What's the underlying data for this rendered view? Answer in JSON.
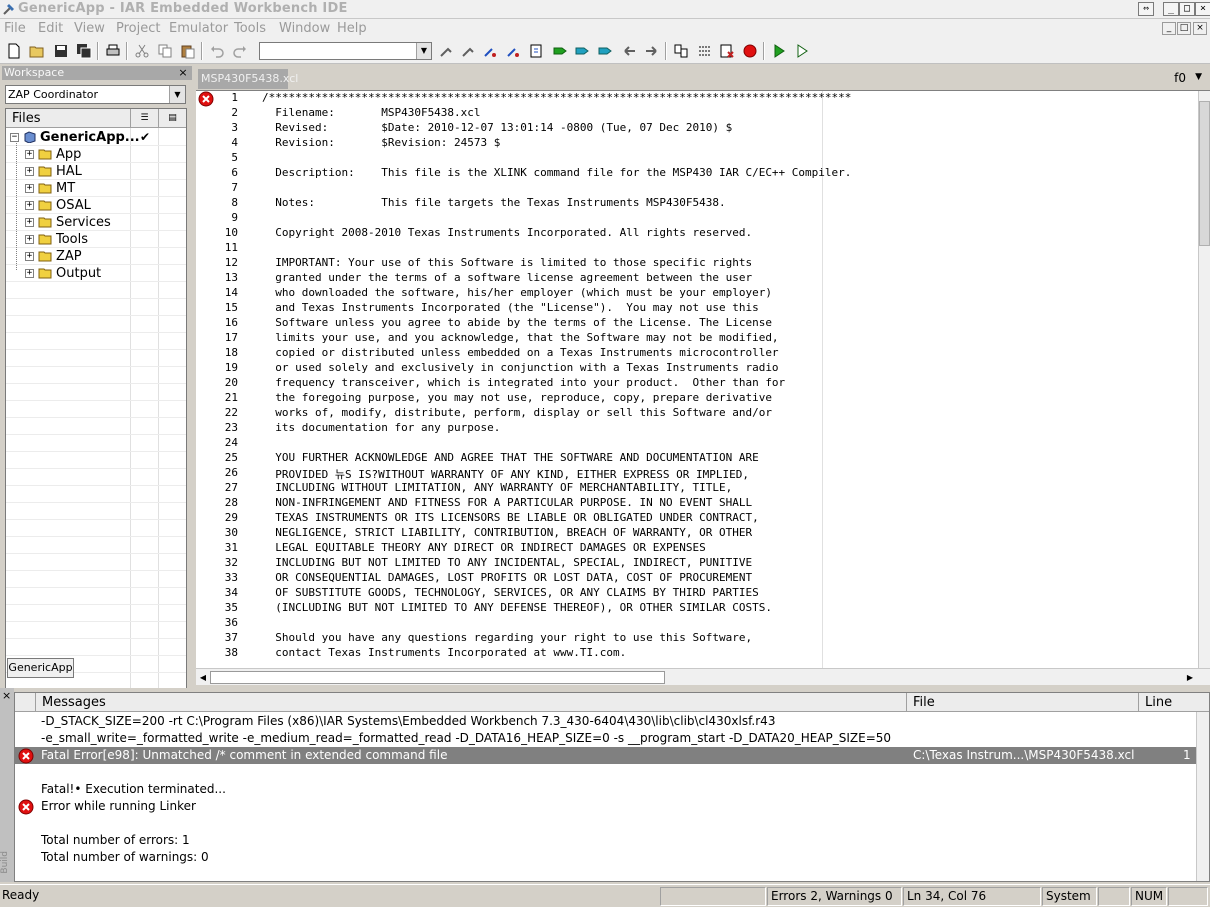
{
  "window": {
    "title": "GenericApp - IAR Embedded Workbench IDE",
    "btn_restore": "⇔",
    "btn_minimize": "_",
    "btn_maximize": "□",
    "btn_close": "×"
  },
  "menu": {
    "items": [
      "File",
      "Edit",
      "View",
      "Project",
      "Emulator",
      "Tools",
      "Window",
      "Help"
    ],
    "mdi_min": "_",
    "mdi_restore": "□",
    "mdi_close": "×"
  },
  "toolbar": {
    "search_value": ""
  },
  "workspace": {
    "title": "Workspace",
    "close": "×",
    "configuration": "ZAP Coordinator",
    "files_header": "Files",
    "root": "GenericApp...",
    "root_check": "✔",
    "folders": [
      "App",
      "HAL",
      "MT",
      "OSAL",
      "Services",
      "Tools",
      "ZAP",
      "Output"
    ],
    "tab": "GenericApp"
  },
  "editor": {
    "tab": "MSP430F5438.xcl",
    "function": "f0",
    "lines": [
      "/****************************************************************************************",
      "  Filename:       MSP430F5438.xcl",
      "  Revised:        $Date: 2010-12-07 13:01:14 -0800 (Tue, 07 Dec 2010) $",
      "  Revision:       $Revision: 24573 $",
      "",
      "  Description:    This file is the XLINK command file for the MSP430 IAR C/EC++ Compiler.",
      "",
      "  Notes:          This file targets the Texas Instruments MSP430F5438.",
      "",
      "  Copyright 2008-2010 Texas Instruments Incorporated. All rights reserved.",
      "",
      "  IMPORTANT: Your use of this Software is limited to those specific rights",
      "  granted under the terms of a software license agreement between the user",
      "  who downloaded the software, his/her employer (which must be your employer)",
      "  and Texas Instruments Incorporated (the \"License\").  You may not use this",
      "  Software unless you agree to abide by the terms of the License. The License",
      "  limits your use, and you acknowledge, that the Software may not be modified,",
      "  copied or distributed unless embedded on a Texas Instruments microcontroller",
      "  or used solely and exclusively in conjunction with a Texas Instruments radio",
      "  frequency transceiver, which is integrated into your product.  Other than for",
      "  the foregoing purpose, you may not use, reproduce, copy, prepare derivative",
      "  works of, modify, distribute, perform, display or sell this Software and/or",
      "  its documentation for any purpose.",
      "",
      "  YOU FURTHER ACKNOWLEDGE AND AGREE THAT THE SOFTWARE AND DOCUMENTATION ARE",
      "  PROVIDED 뉴S IS?WITHOUT WARRANTY OF ANY KIND, EITHER EXPRESS OR IMPLIED,",
      "  INCLUDING WITHOUT LIMITATION, ANY WARRANTY OF MERCHANTABILITY, TITLE,",
      "  NON-INFRINGEMENT AND FITNESS FOR A PARTICULAR PURPOSE. IN NO EVENT SHALL",
      "  TEXAS INSTRUMENTS OR ITS LICENSORS BE LIABLE OR OBLIGATED UNDER CONTRACT,",
      "  NEGLIGENCE, STRICT LIABILITY, CONTRIBUTION, BREACH OF WARRANTY, OR OTHER",
      "  LEGAL EQUITABLE THEORY ANY DIRECT OR INDIRECT DAMAGES OR EXPENSES",
      "  INCLUDING BUT NOT LIMITED TO ANY INCIDENTAL, SPECIAL, INDIRECT, PUNITIVE",
      "  OR CONSEQUENTIAL DAMAGES, LOST PROFITS OR LOST DATA, COST OF PROCUREMENT",
      "  OF SUBSTITUTE GOODS, TECHNOLOGY, SERVICES, OR ANY CLAIMS BY THIRD PARTIES",
      "  (INCLUDING BUT NOT LIMITED TO ANY DEFENSE THEREOF), OR OTHER SIMILAR COSTS.",
      "",
      "  Should you have any questions regarding your right to use this Software,",
      "  contact Texas Instruments Incorporated at www.TI.com."
    ]
  },
  "messages": {
    "side_label": "Build",
    "close": "×",
    "columns": [
      "Messages",
      "File",
      "Line"
    ],
    "rows": [
      {
        "text": "-D_STACK_SIZE=200 -rt C:\\Program Files (x86)\\IAR Systems\\Embedded Workbench 7.3_430-6404\\430\\lib\\clib\\cl430xlsf.r43",
        "file": "",
        "line": "",
        "error": false,
        "selected": false
      },
      {
        "text": "-e_small_write=_formatted_write -e_medium_read=_formatted_read -D_DATA16_HEAP_SIZE=0 -s __program_start -D_DATA20_HEAP_SIZE=50",
        "file": "",
        "line": "",
        "error": false,
        "selected": false
      },
      {
        "text": "Fatal Error[e98]: Unmatched /* comment in extended command file",
        "file": "C:\\Texas Instrum...\\MSP430F5438.xcl",
        "line": "1",
        "error": true,
        "selected": true
      },
      {
        "text": "",
        "file": "",
        "line": "",
        "error": false,
        "selected": false
      },
      {
        "text": "Fatal!• Execution terminated...",
        "file": "",
        "line": "",
        "error": false,
        "selected": false
      },
      {
        "text": "Error while running Linker",
        "file": "",
        "line": "",
        "error": true,
        "selected": false
      },
      {
        "text": "",
        "file": "",
        "line": "",
        "error": false,
        "selected": false
      },
      {
        "text": "Total number of errors: 1",
        "file": "",
        "line": "",
        "error": false,
        "selected": false
      },
      {
        "text": "Total number of warnings: 0",
        "file": "",
        "line": "",
        "error": false,
        "selected": false
      }
    ]
  },
  "status": {
    "ready": "Ready",
    "errors": "Errors 2, Warnings 0",
    "position": "Ln 34, Col 76",
    "system": "System",
    "num": "NUM"
  }
}
